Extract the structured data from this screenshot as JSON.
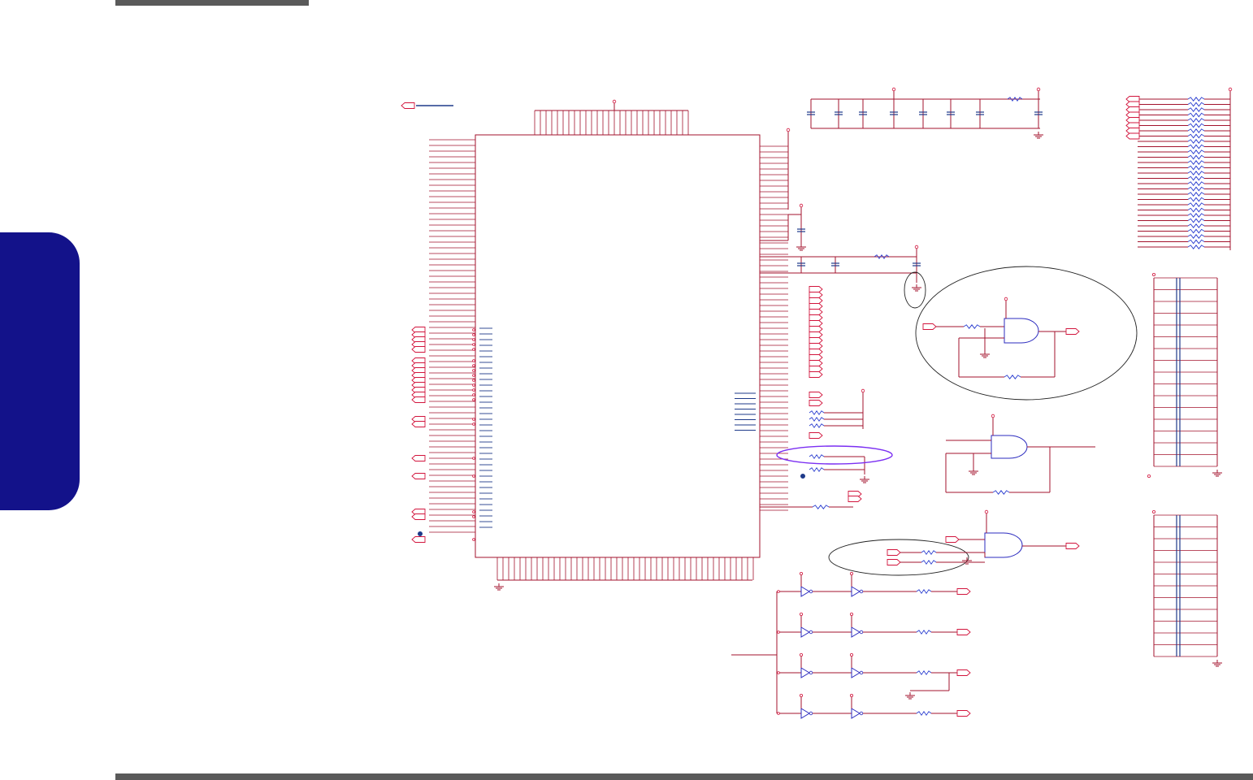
{
  "page": {
    "header_bar": "",
    "side_tab": "",
    "footer_bar": ""
  },
  "schematic": {
    "colors": {
      "wire": "#a3132d",
      "pin": "#d2143c",
      "gate": "#2b2bbf",
      "bus": "#1e3a8a",
      "highlight": "#7b2ff2",
      "ellipse": "#222222",
      "resistor": "#2c3fd0",
      "tab": "#13128a",
      "bar": "#5a5a5a"
    },
    "labels": []
  }
}
